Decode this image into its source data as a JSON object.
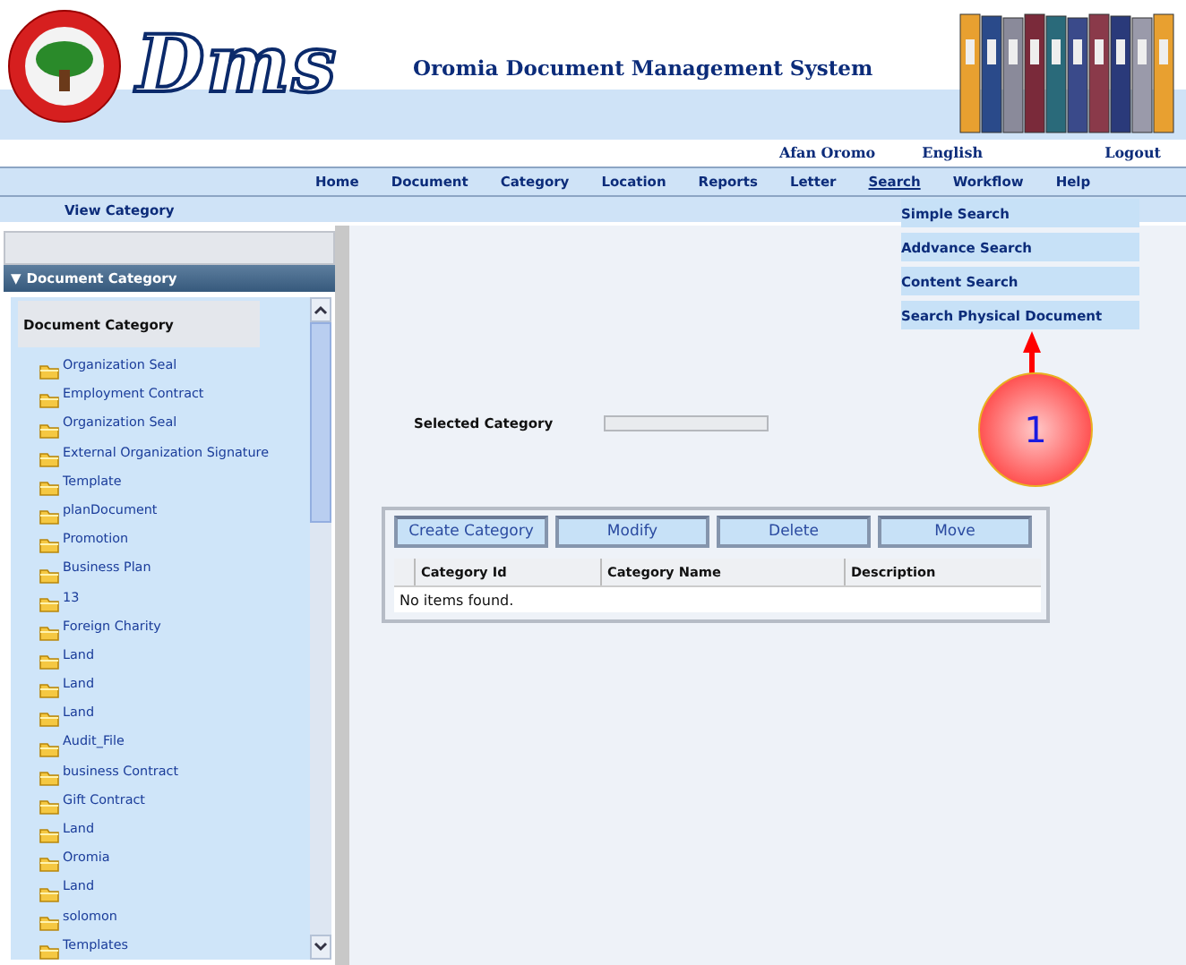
{
  "header": {
    "logo_text": "Dms",
    "title": "Oromia Document Management System",
    "languages": [
      "Afan Oromo",
      "English"
    ],
    "logout": "Logout"
  },
  "nav": [
    {
      "label": "Home",
      "selected": false
    },
    {
      "label": "Document",
      "selected": false
    },
    {
      "label": "Category",
      "selected": false
    },
    {
      "label": "Location",
      "selected": false
    },
    {
      "label": "Reports",
      "selected": false
    },
    {
      "label": "Letter",
      "selected": false
    },
    {
      "label": "Search",
      "selected": true
    },
    {
      "label": "Workflow",
      "selected": false
    },
    {
      "label": "Help",
      "selected": false
    }
  ],
  "breadcrumb": "View Category",
  "search_menu": [
    "Simple Search",
    "Addvance Search",
    "Content Search",
    "Search Physical Document"
  ],
  "callout": "1",
  "sidebar": {
    "toggle": "▼",
    "title": "Document Category",
    "root": "Document Category",
    "items": [
      "Organization Seal",
      "Employment Contract",
      "Organization Seal",
      "External Organization Signature",
      "Template",
      "planDocument",
      "Promotion",
      "Business Plan",
      "13",
      "Foreign Charity",
      "Land",
      "Land",
      "Land",
      "Audit_File",
      "business Contract",
      "Gift Contract",
      "Land",
      "Oromia",
      "Land",
      "solomon",
      "Templates"
    ]
  },
  "selected_category": {
    "label": "Selected Category"
  },
  "buttons": [
    "Create Category",
    "Modify",
    "Delete",
    "Move"
  ],
  "table": {
    "columns": [
      "Category Id",
      "Category Name",
      "Description"
    ],
    "empty": "No items found."
  }
}
